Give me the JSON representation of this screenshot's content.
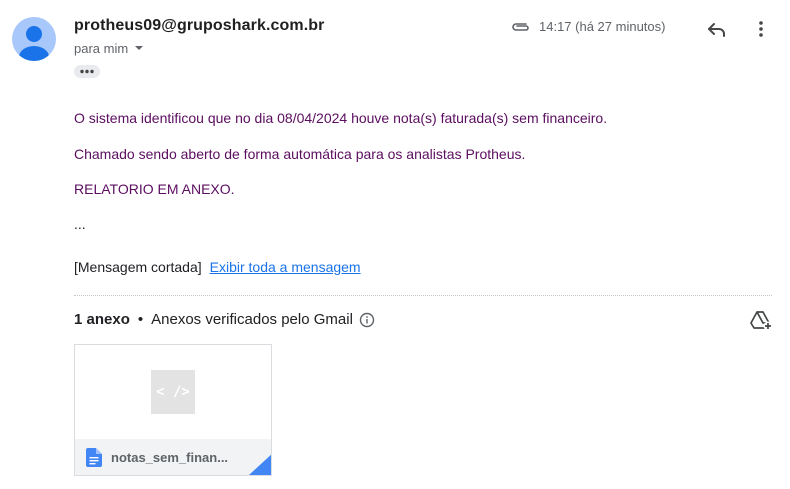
{
  "header": {
    "sender": "protheus09@gruposhark.com.br",
    "recipient_label": "para mim",
    "time": "14:17 (há 27 minutos)",
    "icons": [
      "avatar-icon",
      "paperclip-icon",
      "reply-icon",
      "more-vert-icon",
      "chevron-down-icon",
      "show-trimmed-icon"
    ]
  },
  "body": {
    "line1": "O sistema identificou que no dia 08/04/2024 houve nota(s) faturada(s) sem financeiro.",
    "line2": "Chamado sendo aberto de forma automática para os analistas Protheus.",
    "line3": "RELATORIO EM ANEXO.",
    "ellipsis": "...",
    "trimmed_label": "[Mensagem cortada]",
    "trimmed_link": "Exibir toda a mensagem",
    "text_color": "#5b0d5f"
  },
  "attachments": {
    "count_label": "1 anexo",
    "bullet": "•",
    "scan_label": "Anexos verificados pelo Gmail",
    "file": {
      "name": "notas_sem_finan...",
      "preview_symbol": "< />",
      "icon": "doc-icon"
    }
  },
  "colors": {
    "accent": "#1a73e8",
    "avatar": "#a8c7fa",
    "avatar_figure": "#1a73e8",
    "file_icon": "#4285f4"
  }
}
